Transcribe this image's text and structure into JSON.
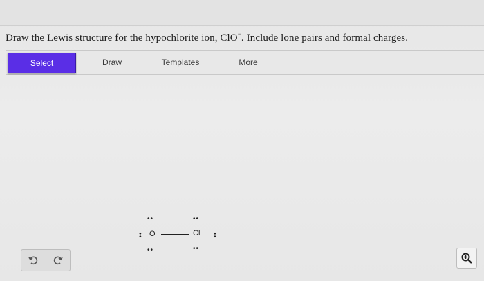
{
  "question": {
    "text_before": "Draw the Lewis structure for the hypochlorite ion, ClO",
    "superscript": "−",
    "text_after": ". Include lone pairs and formal charges."
  },
  "toolbar": {
    "tabs": [
      {
        "label": "Select",
        "active": true
      },
      {
        "label": "Draw",
        "active": false
      },
      {
        "label": "Templates",
        "active": false
      },
      {
        "label": "More",
        "active": false
      }
    ],
    "active_color": "#5a2ee6"
  },
  "molecule": {
    "atoms": [
      {
        "symbol": "O"
      },
      {
        "symbol": "Cl"
      }
    ],
    "lone_pair_glyph": "••"
  },
  "controls": {
    "undo_icon": "undo-icon",
    "redo_icon": "redo-icon",
    "zoom_icon": "zoom-icon"
  }
}
